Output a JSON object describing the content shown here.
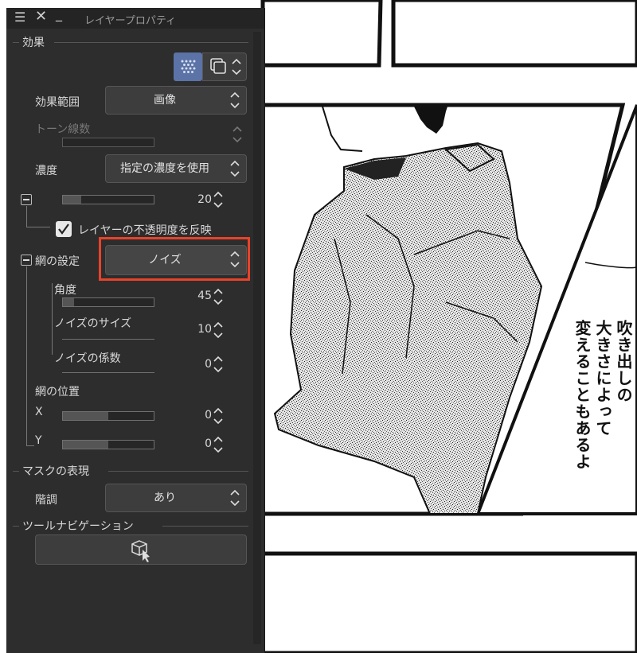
{
  "panel": {
    "title": "レイヤープロパティ",
    "titlebar_icons": [
      "menu-icon",
      "close-icon",
      "minimize-icon"
    ],
    "sections": {
      "effect": "効果",
      "mask": "マスクの表現",
      "toolnav": "ツールナビゲーション"
    },
    "effect_range": {
      "label": "効果範囲",
      "value": "画像"
    },
    "tone_lines": {
      "label": "トーン線数"
    },
    "density": {
      "label": "濃度",
      "value": "指定の濃度を使用",
      "amount": "20",
      "amount_fraction": 0.2
    },
    "reflect_opacity": {
      "label": "レイヤーの不透明度を反映",
      "checked": true
    },
    "halftone": {
      "label": "網の設定",
      "value": "ノイズ"
    },
    "angle": {
      "label": "角度",
      "value": "45",
      "fraction": 0.125
    },
    "noise_size": {
      "label": "ノイズのサイズ",
      "value": "10"
    },
    "noise_factor": {
      "label": "ノイズの係数",
      "value": "0"
    },
    "position": {
      "label": "網の位置",
      "x_label": "X",
      "x_value": "0",
      "y_label": "Y",
      "y_value": "0"
    },
    "gradation": {
      "label": "階調",
      "value": "あり"
    },
    "accent_color": "#e8432a"
  },
  "canvas": {
    "speech_text": [
      "吹き出しの",
      "大きさによって",
      "変えることもあるよ"
    ]
  }
}
